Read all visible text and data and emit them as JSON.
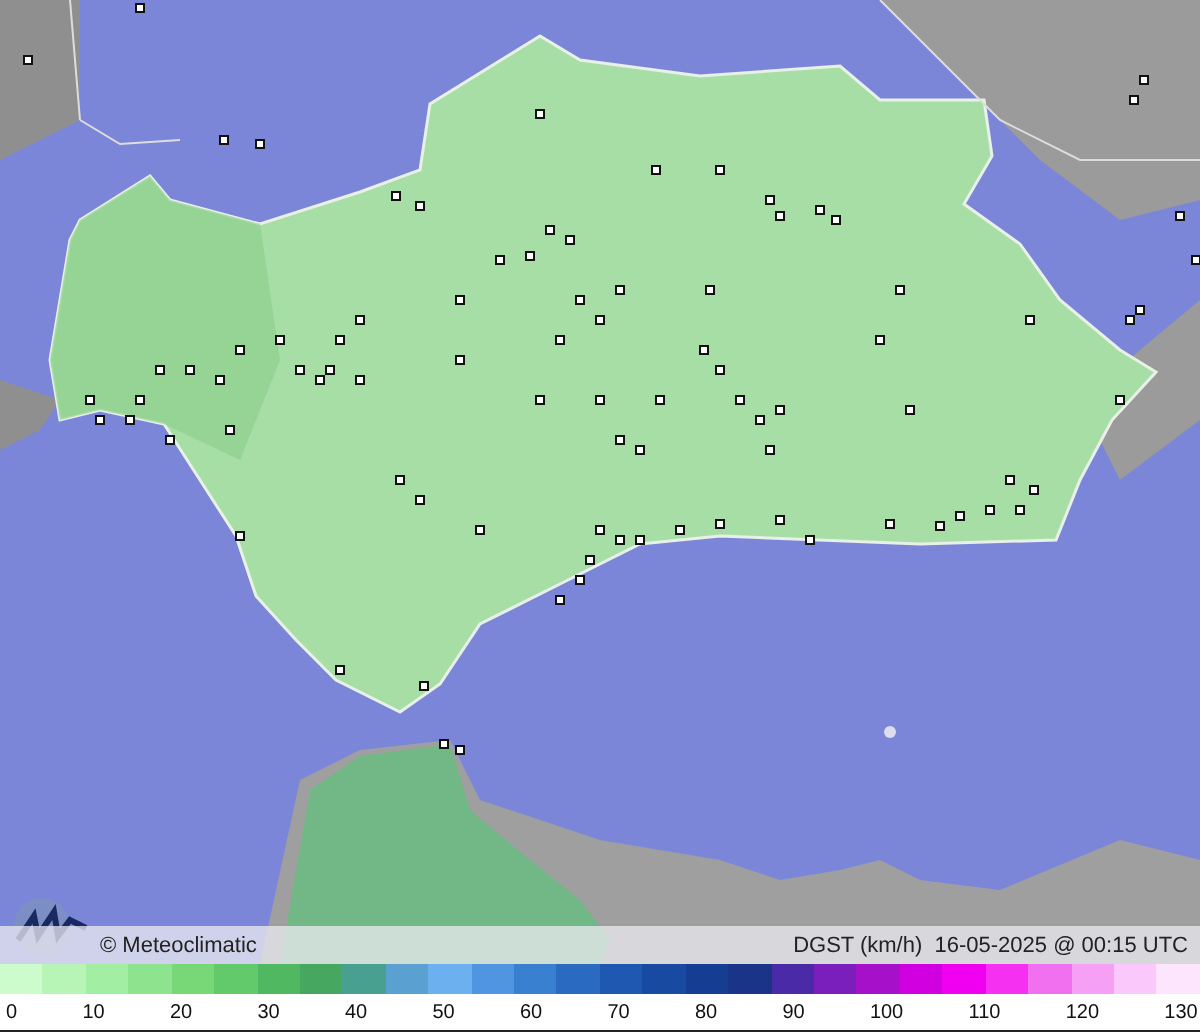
{
  "caption": {
    "credit": "© Meteoclimatic",
    "title": "DGST (km/h)  16-05-2025 @ 00:15 UTC"
  },
  "legend": {
    "ticks": [
      "0",
      "10",
      "20",
      "30",
      "40",
      "50",
      "60",
      "70",
      "80",
      "90",
      "100",
      "110",
      "120",
      "130"
    ]
  }
}
